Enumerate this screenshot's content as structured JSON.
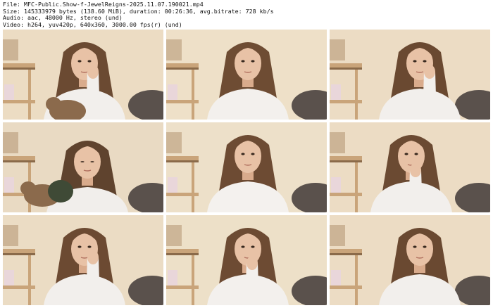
{
  "header": {
    "file_line": "File: MFC-Public.Show-f-JewelReigns-2025.11.07.190021.mp4",
    "size_line": "Size: 145333979 bytes (138.60 MiB), duration: 00:26:36, avg.bitrate: 728 kb/s",
    "audio_line": "Audio: aac, 48000 Hz, stereo (und)",
    "video_line": "Video: h264, yuv420p, 640x360, 3000.00 fps(r) (und)"
  },
  "thumbnails": [
    {
      "wall": "#ecdcc3",
      "shirt": "#f2efec",
      "hair": "#6b4a32",
      "variant": "hand-cheek",
      "dog": true
    },
    {
      "wall": "#eee0c8",
      "shirt": "#f3f0ed",
      "hair": "#6e4c33",
      "variant": "center",
      "dog": false
    },
    {
      "wall": "#ecdcc4",
      "shirt": "#f2efec",
      "hair": "#6a4931",
      "variant": "hand-cheek-right",
      "dog": false
    },
    {
      "wall": "#e9dac3",
      "shirt": "#f1eeeb",
      "hair": "#5f432e",
      "variant": "looking-down",
      "dog": true
    },
    {
      "wall": "#ede0c9",
      "shirt": "#f4f1ee",
      "hair": "#6d4b33",
      "variant": "center",
      "dog": false
    },
    {
      "wall": "#ecdcc4",
      "shirt": "#f2efec",
      "hair": "#6b4a32",
      "variant": "hand-chin",
      "dog": false
    },
    {
      "wall": "#ebdcc4",
      "shirt": "#f2efec",
      "hair": "#6c4a32",
      "variant": "hand-cheek",
      "dog": false
    },
    {
      "wall": "#ede0c8",
      "shirt": "#f3f0ed",
      "hair": "#6d4b33",
      "variant": "hand-chin",
      "dog": false
    },
    {
      "wall": "#ecdcc4",
      "shirt": "#f2efec",
      "hair": "#6a4931",
      "variant": "center-right",
      "dog": false
    }
  ],
  "palette": {
    "skin": "#e8c2a6",
    "skin_shadow": "#d9ab8c",
    "shelf": "#c9a47a",
    "shelf_dark": "#8a6a4a",
    "couch": "#5a514c",
    "pillow": "#e9d6da",
    "dog_fur": "#8b6a4c",
    "dog_coat": "#3f4a36"
  }
}
